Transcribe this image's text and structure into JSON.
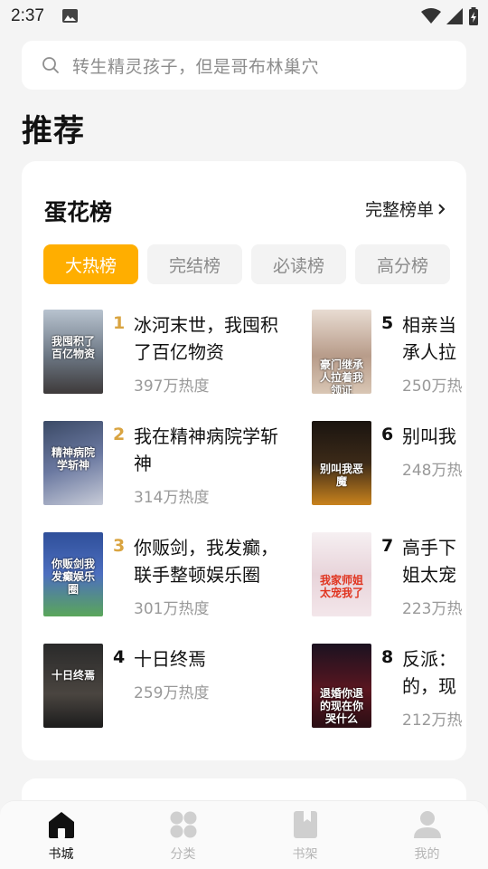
{
  "status_bar": {
    "time": "2:37"
  },
  "search": {
    "placeholder": "转生精灵孩子，但是哥布林巢穴"
  },
  "section": {
    "title": "推荐"
  },
  "rank_card": {
    "title": "蛋花榜",
    "full_list_label": "完整榜单",
    "tabs": [
      {
        "label": "大热榜",
        "active": true
      },
      {
        "label": "完结榜",
        "active": false
      },
      {
        "label": "必读榜",
        "active": false
      },
      {
        "label": "高分榜",
        "active": false
      }
    ],
    "books": [
      {
        "rank": "1",
        "title": "冰河末世，我囤积了百亿物资",
        "heat": "397万热度",
        "cover_text": "我囤积了百亿物资"
      },
      {
        "rank": "2",
        "title": "我在精神病院学斩神",
        "heat": "314万热度",
        "cover_text": "精神病院学斩神"
      },
      {
        "rank": "3",
        "title": "你贩剑，我发癫，联手整顿娱乐圈",
        "heat": "301万热度",
        "cover_text": "你贩剑我发癫娱乐圈"
      },
      {
        "rank": "4",
        "title": "十日终焉",
        "heat": "259万热度",
        "cover_text": "十日终焉"
      },
      {
        "rank": "5",
        "title": "相亲当",
        "title2": "承人拉",
        "heat": "250万热",
        "cover_text": "豪门继承人拉着我领证"
      },
      {
        "rank": "6",
        "title": "别叫我",
        "heat": "248万热",
        "cover_text": "别叫我恶魔"
      },
      {
        "rank": "7",
        "title": "高手下",
        "title2": "姐太宠",
        "heat": "223万热",
        "cover_text": "我家师姐太宠我了"
      },
      {
        "rank": "8",
        "title": "反派：",
        "title2": "的，现",
        "heat": "212万热",
        "cover_text": "退婚你退的现在你哭什么"
      }
    ]
  },
  "bottom_nav": {
    "items": [
      {
        "label": "书城",
        "icon": "home-icon",
        "active": true
      },
      {
        "label": "分类",
        "icon": "category-icon",
        "active": false
      },
      {
        "label": "书架",
        "icon": "bookshelf-icon",
        "active": false
      },
      {
        "label": "我的",
        "icon": "profile-icon",
        "active": false
      }
    ]
  },
  "colors": {
    "accent": "#ffae00",
    "rank_top": "#d9a441",
    "rank_other": "#111111"
  }
}
